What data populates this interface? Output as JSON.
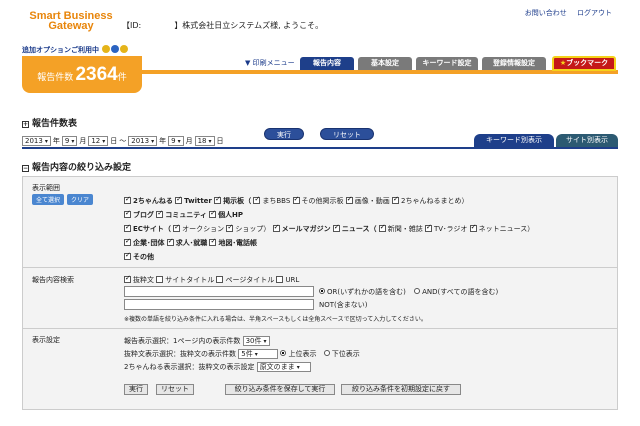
{
  "header": {
    "logo_line1": "Smart Business",
    "logo_line2": "Gateway",
    "user_id_label": "【ID:",
    "welcome": "】株式会社日立システムズ様, ようこそ。",
    "link_contact": "お問い合わせ",
    "link_logout": "ログアウト",
    "option_text": "追加オプションご利用中"
  },
  "count": {
    "label": "報告件数",
    "value": "2364",
    "unit": "件"
  },
  "nav": {
    "print": "▼ 印刷メニュー",
    "tabs": [
      "報告内容",
      "基本設定",
      "キーワード設定",
      "登録情報設定"
    ],
    "bookmark": "ブックマーク"
  },
  "report_count_section": {
    "title": "報告件数表",
    "from_year": "2013",
    "year_unit": "年",
    "from_month": "9",
    "month_unit": "月",
    "from_day": "12",
    "day_unit": "日",
    "tilde": "～",
    "to_year": "2013",
    "to_month": "9",
    "to_day": "18",
    "run_button": "実行",
    "reset_button": "リセット",
    "view_keyword": "キーワード別表示",
    "view_site": "サイト別表示"
  },
  "filter": {
    "title": "報告内容の絞り込み設定",
    "range_label": "表示範囲",
    "select_all": "全て選択",
    "clear": "クリア",
    "row1": [
      "2ちゃんねる",
      "Twitter",
      "掲示板（",
      "まちBBS",
      "その他掲示板",
      "画像・動画",
      "2ちゃんねるまとめ）"
    ],
    "row2": [
      "ブログ",
      "コミュニティ",
      "個人HP"
    ],
    "row3": [
      "ECサイト（",
      "オークション",
      "ショップ）",
      "メールマガジン",
      "ニュース（",
      "新聞・雑誌",
      "TV･ラジオ",
      "ネットニュース）"
    ],
    "row4": [
      "企業･団体",
      "求人･就職",
      "地図･電話帳"
    ],
    "row5": [
      "その他"
    ],
    "search_label": "報告内容検索",
    "search_targets": [
      "抜粋文",
      "サイトタイトル",
      "ページタイトル",
      "URL"
    ],
    "or_label": "OR(いずれかの語を含む)",
    "and_label": "AND(すべての語を含む)",
    "not_label": "NOT(含まない)",
    "note": "※複数の単語を絞り込み条件に入れる場合は、半角スペースもしくは全角スペースで区切って入力してください。",
    "display_label": "表示設定",
    "per_page_label": "報告表示選択：1ページ内の表示件数",
    "per_page_value": "30件",
    "excerpt_label": "抜粋文表示選択：抜粋文の表示件数",
    "excerpt_value": "5件",
    "order_top": "上位表示",
    "order_bottom": "下位表示",
    "ch2_label": "2ちゃんねる表示選択：抜粋文の表示設定",
    "ch2_value": "原文のまま",
    "btn_run": "実行",
    "btn_reset": "リセット",
    "btn_save": "絞り込み条件を保存して実行",
    "btn_default": "絞り込み条件を初期設定に戻す"
  }
}
